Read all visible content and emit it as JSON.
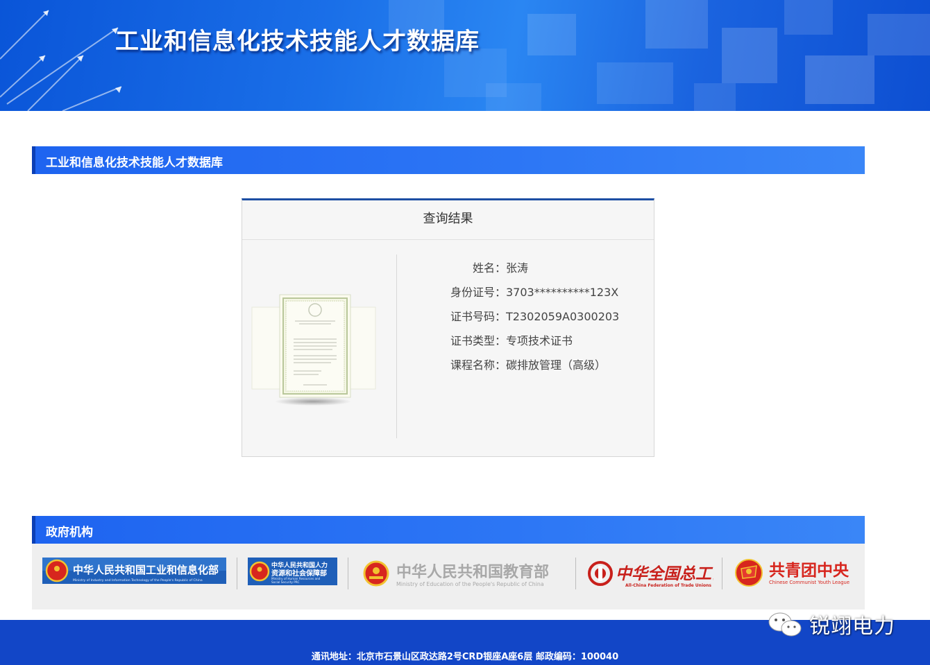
{
  "banner": {
    "title": "工业和信息化技术技能人才数据库"
  },
  "section": {
    "title": "工业和信息化技术技能人才数据库"
  },
  "result": {
    "title": "查询结果",
    "fields": [
      {
        "label": "姓名：",
        "value": "张涛"
      },
      {
        "label": "身份证号：",
        "value": "3703**********123X"
      },
      {
        "label": "证书号码：",
        "value": "T2302059A0300203"
      },
      {
        "label": "证书类型：",
        "value": "专项技术证书"
      },
      {
        "label": "课程名称：",
        "value": "碳排放管理（高级）"
      }
    ]
  },
  "gov": {
    "title": "政府机构",
    "logos": [
      {
        "name": "中华人民共和国工业和信息化部",
        "sub": "Ministry of Industry and Information Technology of the People's Republic of China"
      },
      {
        "name": "中华人民共和国人力资源和社会保障部",
        "line1": "中华人民共和国人力",
        "line2": "资源和社会保障部",
        "sub1": "Ministry of Human Resources and",
        "sub2": "Social Security PRC"
      },
      {
        "name": "中华人民共和国教育部",
        "sub": "Ministry of Education of the People's Republic of China"
      },
      {
        "name": "中华全国总工会",
        "sub": "All-China Federation of Trade Unions"
      },
      {
        "name": "共青团中央",
        "sub": "Chinese Communist Youth League"
      }
    ]
  },
  "footer": {
    "address": "通讯地址：北京市石景山区政达路2号CRD银座A座6层  邮政编码：100040"
  },
  "watermark": {
    "text": "锐翊电力"
  },
  "colors": {
    "banner": "#1a6fe8",
    "section_bar": "#2d77f5",
    "card_top": "#1c4ea3",
    "footer": "#1246c7",
    "emblem_red": "#d7261e",
    "emblem_gold": "#f2c230"
  }
}
